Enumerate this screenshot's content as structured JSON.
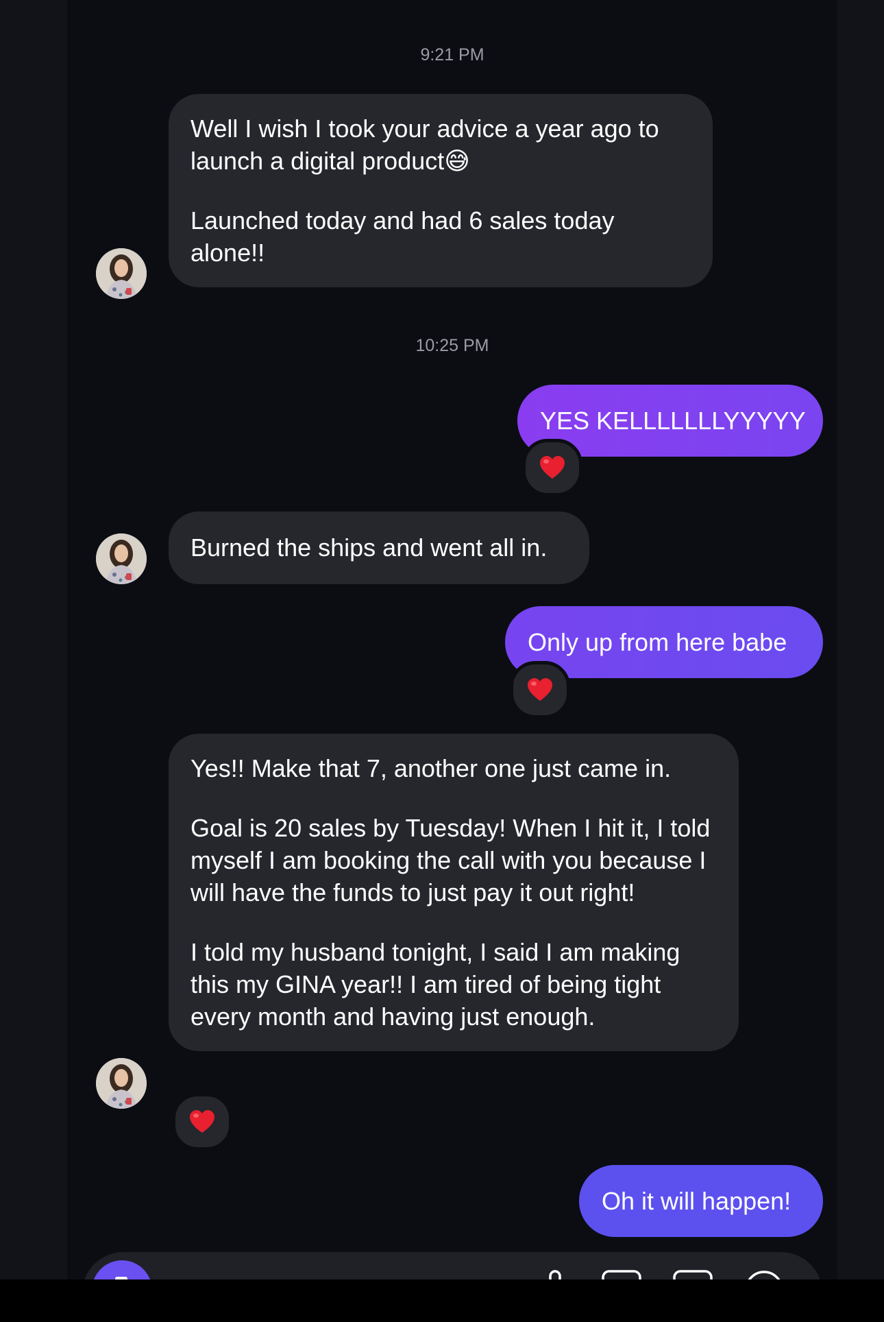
{
  "thread": {
    "timestamps": [
      "9:21 PM",
      "10:25 PM"
    ],
    "messages": [
      {
        "id": "m1",
        "from": "other",
        "paragraphs": [
          "Well I wish I took your advice a year ago to launch a digital product😅",
          "Launched today and had 6 sales today alone!!"
        ]
      },
      {
        "id": "m2",
        "from": "me",
        "text": "YES KELLLLLLLYYYYY",
        "reaction": "❤️"
      },
      {
        "id": "m3",
        "from": "other",
        "paragraphs": [
          "Burned the ships and went all in."
        ]
      },
      {
        "id": "m4",
        "from": "me",
        "text": "Only up from here babe",
        "reaction": "❤️"
      },
      {
        "id": "m5",
        "from": "other",
        "paragraphs": [
          "Yes!! Make that 7, another one just came in.",
          "Goal is 20 sales by Tuesday! When I hit it, I told myself I am booking the call with you because I will have the funds to just pay it out right!",
          "I told my husband tonight, I said I am making this my GINA year!! I am tired of being tight every month and having just enough."
        ],
        "reaction": "❤️"
      },
      {
        "id": "m6",
        "from": "me",
        "text": "Oh it will happen!"
      }
    ]
  },
  "composer": {
    "icons": [
      "camera-icon",
      "microphone-icon",
      "gallery-icon",
      "sticker-icon",
      "plus-icon"
    ]
  },
  "colors": {
    "background": "#0b0d13",
    "received_bubble": "#25272d",
    "sent_bubble_gradient": [
      "#8a3df0",
      "#5e52f0"
    ],
    "sent_last": "#5c51ef",
    "timestamp": "#9b9ba3",
    "heart": "#e8202f"
  }
}
